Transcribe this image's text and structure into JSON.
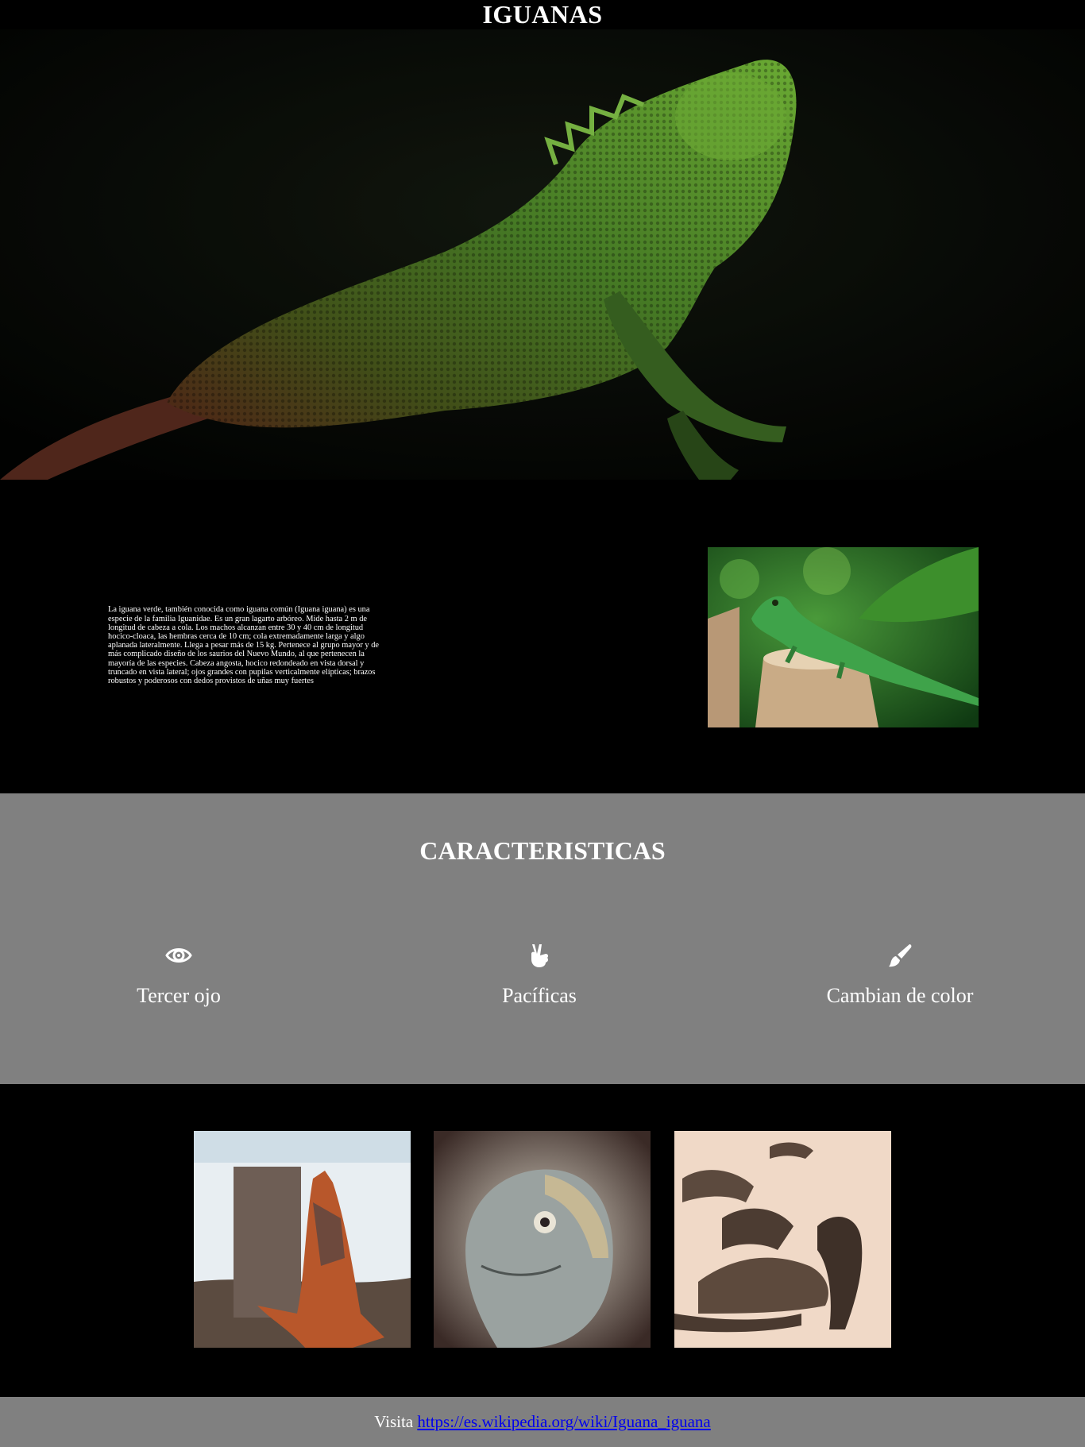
{
  "header": {
    "title": "IGUANAS"
  },
  "intro": {
    "description": "La iguana verde, también conocida como iguana común (Iguana iguana) es una especie de la familia Iguanidae. Es un gran lagarto arbóreo. Mide hasta 2 m de longitud de cabeza a cola. Los machos alcanzan entre 30 y 40 cm de longitud hocico-cloaca, las hembras cerca de 10 cm; cola extremadamente larga y algo aplanada lateralmente. Llega a pesar más de 15 kg. Pertenece al grupo mayor y de más complicado diseño de los saurios del Nuevo Mundo, al que pertenecen la mayoría de las especies. Cabeza angosta, hocico redondeado en vista dorsal y truncado en vista lateral; ojos grandes con pupilas verticalmente elípticas; brazos robustos y poderosos con dedos provistos de uñas muy fuertes"
  },
  "features": {
    "title": "CARACTERISTICAS",
    "items": [
      {
        "label": "Tercer ojo",
        "icon": "eye-icon"
      },
      {
        "label": "Pacíficas",
        "icon": "peace-hand-icon"
      },
      {
        "label": "Cambian de color",
        "icon": "paint-brush-icon"
      }
    ]
  },
  "footer": {
    "prefix": "Visita",
    "link_text": "https://es.wikipedia.org/wiki/Iguana_iguana"
  },
  "colors": {
    "page_background": "#000000",
    "features_background": "#808080",
    "footer_background": "#808080",
    "link": "#0000ee",
    "text": "#ffffff"
  }
}
